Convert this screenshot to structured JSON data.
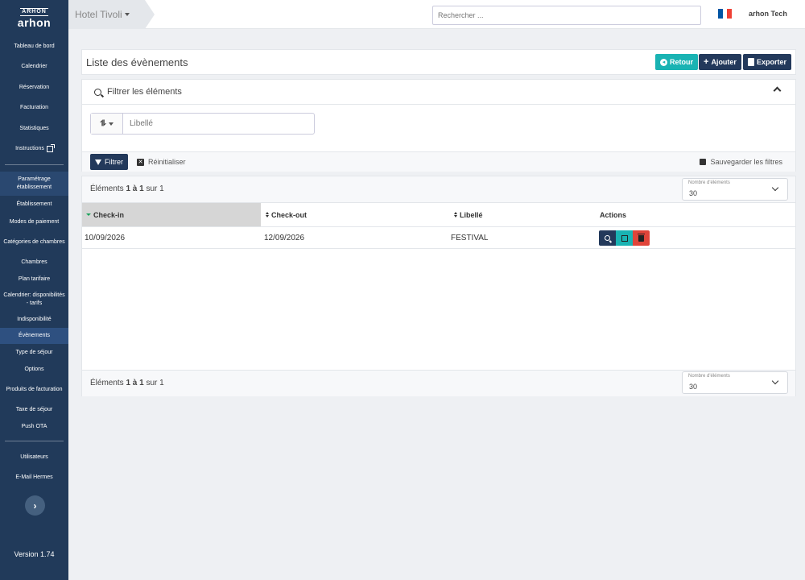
{
  "sidebar": {
    "logo_top": "ARHON",
    "logo_main": "arhon",
    "items": [
      {
        "label": "Tableau de bord"
      },
      {
        "label": "Calendrier"
      },
      {
        "label": "Réservation"
      },
      {
        "label": "Facturation"
      },
      {
        "label": "Statistiques"
      },
      {
        "label": "Instructions"
      }
    ],
    "section_label": "Paramétrage établissement",
    "sub_items": [
      {
        "label": "Établissement"
      },
      {
        "label": "Modes de paiement"
      },
      {
        "label": "Catégories de chambres"
      },
      {
        "label": "Chambres"
      },
      {
        "label": "Plan tarifaire"
      },
      {
        "label": "Calendrier: disponibilités - tarifs"
      },
      {
        "label": "Indisponibilité"
      },
      {
        "label": "Évènements"
      },
      {
        "label": "Type de séjour"
      },
      {
        "label": "Options"
      },
      {
        "label": "Produits de facturation"
      },
      {
        "label": "Taxe de séjour"
      },
      {
        "label": "Push OTA"
      }
    ],
    "bottom_items": [
      {
        "label": "Utilisateurs"
      },
      {
        "label": "E-Mail Hermes"
      }
    ],
    "toggle_glyph": "›",
    "version": "Version 1.74"
  },
  "topbar": {
    "hotel": "Hotel Tivoli",
    "search_placeholder": "Rechercher ...",
    "user": "arhon Tech",
    "flag_colors": [
      "#0055a4",
      "#ffffff",
      "#ef4135"
    ]
  },
  "header": {
    "title": "Liste des évènements",
    "back_label": "Retour",
    "add_label": "Ajouter",
    "export_label": "Exporter"
  },
  "filter": {
    "title": "Filtrer les éléments",
    "operator_glyph": "⥮",
    "libelle_placeholder": "Libellé",
    "filter_label": "Filtrer",
    "reset_label": "Réinitialiser",
    "save_label": "Sauvegarder les filtres"
  },
  "table": {
    "count_prefix": "Éléments",
    "count_range": "1 à 1",
    "count_suffix": "sur 1",
    "page_size_label": "Nombre d'éléments",
    "page_size_value": "30",
    "columns": [
      "Check-in",
      "Check-out",
      "Libellé",
      "Actions"
    ],
    "rows": [
      {
        "checkin": "10/09/2026",
        "checkout": "12/09/2026",
        "libelle": "FESTIVAL"
      }
    ]
  }
}
